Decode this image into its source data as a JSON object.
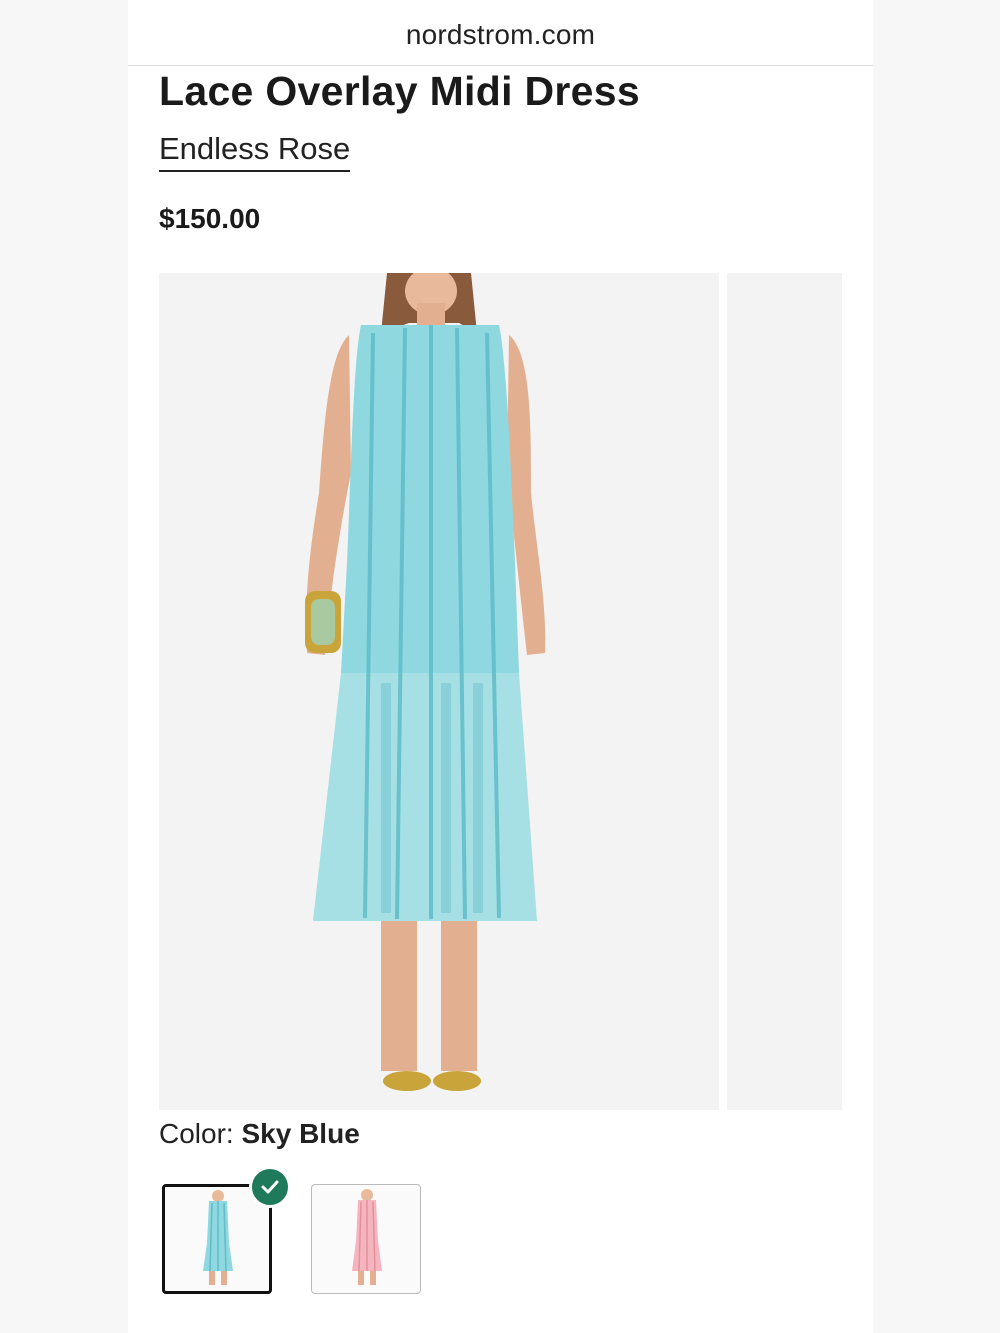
{
  "browser": {
    "url": "nordstrom.com"
  },
  "product": {
    "title": "Lace Overlay Midi Dress",
    "brand": "Endless Rose",
    "price": "$150.00",
    "color_label": "Color:",
    "color_value": "Sky Blue",
    "swatches": [
      {
        "name": "Sky Blue",
        "selected": true,
        "color": "#8fd8df"
      },
      {
        "name": "Pink",
        "selected": false,
        "color": "#f4b5bf"
      }
    ]
  },
  "colors": {
    "accent_check": "#1f7a5c",
    "dress_blue": "#8fd8df"
  }
}
